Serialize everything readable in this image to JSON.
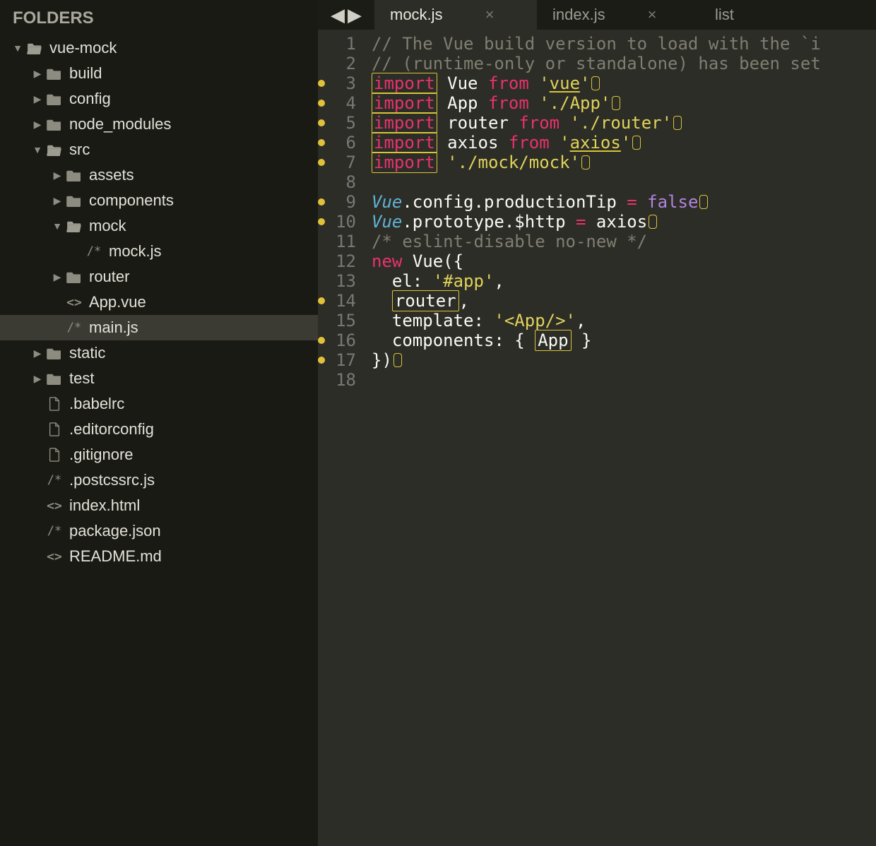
{
  "sidebar": {
    "title": "FOLDERS",
    "tree": [
      {
        "depth": 0,
        "type": "folder",
        "open": true,
        "name": "vue-mock"
      },
      {
        "depth": 1,
        "type": "folder",
        "open": false,
        "closed": true,
        "name": "build"
      },
      {
        "depth": 1,
        "type": "folder",
        "open": false,
        "closed": true,
        "name": "config"
      },
      {
        "depth": 1,
        "type": "folder",
        "open": false,
        "closed": true,
        "name": "node_modules"
      },
      {
        "depth": 1,
        "type": "folder",
        "open": true,
        "name": "src"
      },
      {
        "depth": 2,
        "type": "folder",
        "open": false,
        "closed": true,
        "name": "assets"
      },
      {
        "depth": 2,
        "type": "folder",
        "open": false,
        "closed": true,
        "name": "components"
      },
      {
        "depth": 2,
        "type": "folder",
        "open": true,
        "name": "mock"
      },
      {
        "depth": 3,
        "type": "js",
        "name": "mock.js"
      },
      {
        "depth": 2,
        "type": "folder",
        "open": false,
        "closed": true,
        "name": "router"
      },
      {
        "depth": 2,
        "type": "code",
        "name": "App.vue"
      },
      {
        "depth": 2,
        "type": "js",
        "name": "main.js",
        "selected": true
      },
      {
        "depth": 1,
        "type": "folder",
        "open": false,
        "closed": true,
        "name": "static"
      },
      {
        "depth": 1,
        "type": "folder",
        "open": false,
        "closed": true,
        "name": "test"
      },
      {
        "depth": 1,
        "type": "file",
        "name": ".babelrc"
      },
      {
        "depth": 1,
        "type": "file",
        "name": ".editorconfig"
      },
      {
        "depth": 1,
        "type": "file",
        "name": ".gitignore"
      },
      {
        "depth": 1,
        "type": "js",
        "name": ".postcssrc.js"
      },
      {
        "depth": 1,
        "type": "code",
        "name": "index.html"
      },
      {
        "depth": 1,
        "type": "js",
        "name": "package.json"
      },
      {
        "depth": 1,
        "type": "code",
        "name": "README.md"
      }
    ]
  },
  "tabs": [
    {
      "label": "mock.js",
      "active": true,
      "close": true
    },
    {
      "label": "index.js",
      "active": false,
      "close": true
    },
    {
      "label": "list",
      "active": false,
      "close": false
    }
  ],
  "code": {
    "lines": [
      {
        "n": 1,
        "dot": false,
        "tokens": [
          [
            "com",
            "// The Vue build version to load with the `i"
          ]
        ]
      },
      {
        "n": 2,
        "dot": false,
        "tokens": [
          [
            "com",
            "// (runtime-only or standalone) has been set"
          ]
        ]
      },
      {
        "n": 3,
        "dot": true,
        "tokens": [
          [
            "kwb",
            "import"
          ],
          [
            "sp",
            " "
          ],
          [
            "id",
            "Vue"
          ],
          [
            "sp",
            " "
          ],
          [
            "kw",
            "from"
          ],
          [
            "sp",
            " "
          ],
          [
            "str",
            "'"
          ],
          [
            "stru",
            "vue"
          ],
          [
            "str",
            "'"
          ],
          [
            "we",
            ""
          ]
        ]
      },
      {
        "n": 4,
        "dot": true,
        "tokens": [
          [
            "kwb",
            "import"
          ],
          [
            "sp",
            " "
          ],
          [
            "id",
            "App"
          ],
          [
            "sp",
            " "
          ],
          [
            "kw",
            "from"
          ],
          [
            "sp",
            " "
          ],
          [
            "str",
            "'./App'"
          ],
          [
            "we",
            ""
          ]
        ]
      },
      {
        "n": 5,
        "dot": true,
        "tokens": [
          [
            "kwb",
            "import"
          ],
          [
            "sp",
            " "
          ],
          [
            "id",
            "router"
          ],
          [
            "sp",
            " "
          ],
          [
            "kw",
            "from"
          ],
          [
            "sp",
            " "
          ],
          [
            "str",
            "'./router'"
          ],
          [
            "we",
            ""
          ]
        ]
      },
      {
        "n": 6,
        "dot": true,
        "tokens": [
          [
            "kwb",
            "import"
          ],
          [
            "sp",
            " "
          ],
          [
            "id",
            "axios"
          ],
          [
            "sp",
            " "
          ],
          [
            "kw",
            "from"
          ],
          [
            "sp",
            " "
          ],
          [
            "str",
            "'"
          ],
          [
            "stru",
            "axios"
          ],
          [
            "str",
            "'"
          ],
          [
            "we",
            ""
          ]
        ]
      },
      {
        "n": 7,
        "dot": true,
        "tokens": [
          [
            "kwb",
            "import"
          ],
          [
            "sp",
            " "
          ],
          [
            "str",
            "'./mock/mock'"
          ],
          [
            "we",
            ""
          ]
        ]
      },
      {
        "n": 8,
        "dot": false,
        "tokens": []
      },
      {
        "n": 9,
        "dot": true,
        "tokens": [
          [
            "type",
            "Vue"
          ],
          [
            "id",
            ".config.productionTip "
          ],
          [
            "kw",
            "="
          ],
          [
            "sp",
            " "
          ],
          [
            "bool",
            "false"
          ],
          [
            "we",
            ""
          ]
        ]
      },
      {
        "n": 10,
        "dot": true,
        "tokens": [
          [
            "type",
            "Vue"
          ],
          [
            "id",
            ".prototype"
          ],
          [
            "id",
            ".$http "
          ],
          [
            "kw",
            "="
          ],
          [
            "sp",
            " "
          ],
          [
            "id",
            "axios"
          ],
          [
            "we",
            ""
          ]
        ]
      },
      {
        "n": 11,
        "dot": false,
        "tokens": [
          [
            "com",
            "/* eslint-disable no-new */"
          ]
        ]
      },
      {
        "n": 12,
        "dot": false,
        "tokens": [
          [
            "kw",
            "new"
          ],
          [
            "sp",
            " "
          ],
          [
            "id",
            "Vue({"
          ]
        ]
      },
      {
        "n": 13,
        "dot": false,
        "tokens": [
          [
            "sp",
            "  "
          ],
          [
            "id",
            "el: "
          ],
          [
            "str",
            "'#app'"
          ],
          [
            "id",
            ","
          ]
        ]
      },
      {
        "n": 14,
        "dot": true,
        "tokens": [
          [
            "sp",
            "  "
          ],
          [
            "ybox",
            "router"
          ],
          [
            "id",
            ","
          ]
        ]
      },
      {
        "n": 15,
        "dot": false,
        "tokens": [
          [
            "sp",
            "  "
          ],
          [
            "id",
            "template: "
          ],
          [
            "str",
            "'<App/>'"
          ],
          [
            "id",
            ","
          ]
        ]
      },
      {
        "n": 16,
        "dot": true,
        "tokens": [
          [
            "sp",
            "  "
          ],
          [
            "id",
            "components: { "
          ],
          [
            "ybox",
            "App"
          ],
          [
            "id",
            " }"
          ]
        ]
      },
      {
        "n": 17,
        "dot": true,
        "tokens": [
          [
            "id",
            "})"
          ],
          [
            "we",
            ""
          ]
        ]
      },
      {
        "n": 18,
        "dot": false,
        "tokens": []
      }
    ]
  }
}
